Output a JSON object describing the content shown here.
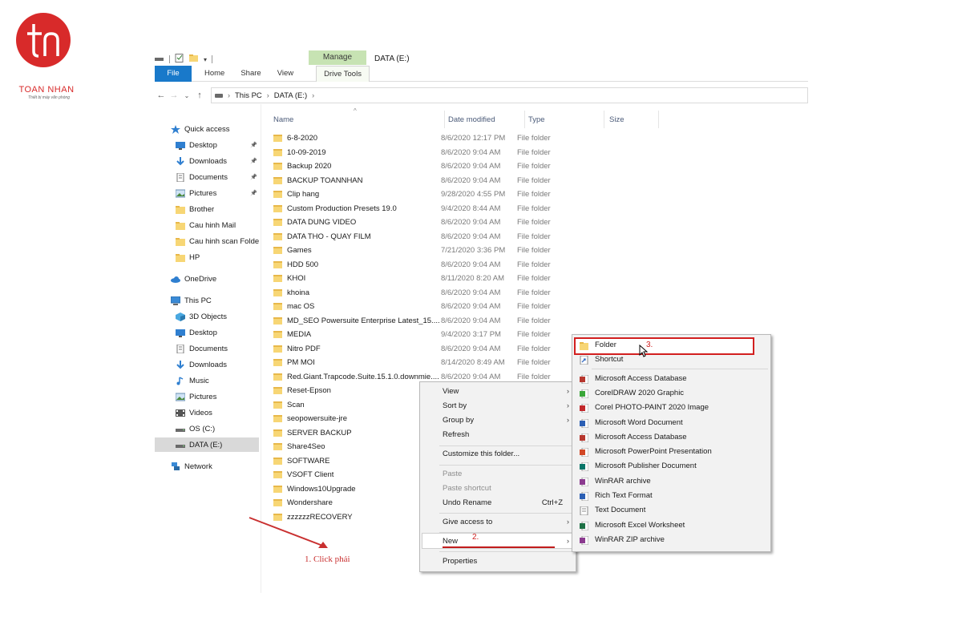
{
  "logo": {
    "name": "TOAN NHAN",
    "tagline": "Thiết bị máy văn phòng",
    "brand_color": "#d82a2a"
  },
  "window": {
    "title": "DATA (E:)",
    "context_tab": "Manage"
  },
  "ribbon": {
    "tabs": [
      "File",
      "Home",
      "Share",
      "View",
      "Drive Tools"
    ],
    "file_color": "#1979ca",
    "manage_color": "#c7e3b3"
  },
  "address": {
    "crumbs": [
      "This PC",
      "DATA (E:)"
    ]
  },
  "nav": {
    "quick_access": "Quick access",
    "items": [
      {
        "label": "Quick access",
        "icon": "star-icon"
      },
      {
        "label": "Desktop",
        "icon": "desktop-icon",
        "pinned": true
      },
      {
        "label": "Downloads",
        "icon": "download-icon",
        "pinned": true
      },
      {
        "label": "Documents",
        "icon": "documents-icon",
        "pinned": true
      },
      {
        "label": "Pictures",
        "icon": "pictures-icon",
        "pinned": true
      },
      {
        "label": "Brother",
        "icon": "folder-icon"
      },
      {
        "label": "Cau hinh Mail",
        "icon": "folder-icon"
      },
      {
        "label": "Cau hinh scan Folder",
        "icon": "folder-icon"
      },
      {
        "label": "HP",
        "icon": "folder-icon"
      },
      {
        "label": "OneDrive",
        "icon": "cloud-icon"
      },
      {
        "label": "This PC",
        "icon": "computer-icon"
      },
      {
        "label": "3D Objects",
        "icon": "cube-icon"
      },
      {
        "label": "Desktop",
        "icon": "desktop-icon"
      },
      {
        "label": "Documents",
        "icon": "documents-icon"
      },
      {
        "label": "Downloads",
        "icon": "download-icon"
      },
      {
        "label": "Music",
        "icon": "music-icon"
      },
      {
        "label": "Pictures",
        "icon": "pictures-icon"
      },
      {
        "label": "Videos",
        "icon": "video-icon"
      },
      {
        "label": "OS (C:)",
        "icon": "drive-icon"
      },
      {
        "label": "DATA (E:)",
        "icon": "drive-icon",
        "selected": true
      },
      {
        "label": "Network",
        "icon": "network-icon"
      }
    ]
  },
  "columns": {
    "name": "Name",
    "date": "Date modified",
    "type": "Type",
    "size": "Size"
  },
  "files": [
    {
      "name": "6-8-2020",
      "date": "8/6/2020 12:17 PM",
      "type": "File folder"
    },
    {
      "name": "10-09-2019",
      "date": "8/6/2020 9:04 AM",
      "type": "File folder"
    },
    {
      "name": "Backup 2020",
      "date": "8/6/2020 9:04 AM",
      "type": "File folder"
    },
    {
      "name": "BACKUP TOANNHAN",
      "date": "8/6/2020 9:04 AM",
      "type": "File folder"
    },
    {
      "name": "Clip hang",
      "date": "9/28/2020 4:55 PM",
      "type": "File folder"
    },
    {
      "name": "Custom Production Presets 19.0",
      "date": "9/4/2020 8:44 AM",
      "type": "File folder"
    },
    {
      "name": "DATA DUNG VIDEO",
      "date": "8/6/2020 9:04 AM",
      "type": "File folder"
    },
    {
      "name": "DATA THO - QUAY FILM",
      "date": "8/6/2020 9:04 AM",
      "type": "File folder"
    },
    {
      "name": "Games",
      "date": "7/21/2020 3:36 PM",
      "type": "File folder"
    },
    {
      "name": "HDD 500",
      "date": "8/6/2020 9:04 AM",
      "type": "File folder"
    },
    {
      "name": "KHOI",
      "date": "8/11/2020 8:20 AM",
      "type": "File folder"
    },
    {
      "name": "khoina",
      "date": "8/6/2020 9:04 AM",
      "type": "File folder"
    },
    {
      "name": "mac OS",
      "date": "8/6/2020 9:04 AM",
      "type": "File folder"
    },
    {
      "name": "MD_SEO Powersuite Enterprise Latest_15....",
      "date": "8/6/2020 9:04 AM",
      "type": "File folder"
    },
    {
      "name": "MEDIA",
      "date": "9/4/2020 3:17 PM",
      "type": "File folder"
    },
    {
      "name": "Nitro PDF",
      "date": "8/6/2020 9:04 AM",
      "type": "File folder"
    },
    {
      "name": "PM MOI",
      "date": "8/14/2020 8:49 AM",
      "type": "File folder"
    },
    {
      "name": "Red.Giant.Trapcode.Suite.15.1.0.downmie....",
      "date": "8/6/2020 9:04 AM",
      "type": "File folder"
    },
    {
      "name": "Reset-Epson",
      "date": "",
      "type": ""
    },
    {
      "name": "Scan",
      "date": "",
      "type": ""
    },
    {
      "name": "seopowersuite-jre",
      "date": "",
      "type": ""
    },
    {
      "name": "SERVER BACKUP",
      "date": "",
      "type": ""
    },
    {
      "name": "Share4Seo",
      "date": "",
      "type": ""
    },
    {
      "name": "SOFTWARE",
      "date": "",
      "type": ""
    },
    {
      "name": "VSOFT Client",
      "date": "",
      "type": ""
    },
    {
      "name": "Windows10Upgrade",
      "date": "",
      "type": ""
    },
    {
      "name": "Wondershare",
      "date": "",
      "type": ""
    },
    {
      "name": "zzzzzzRECOVERY",
      "date": "",
      "type": ""
    }
  ],
  "context_menu": {
    "view": "View",
    "sort_by": "Sort by",
    "group_by": "Group by",
    "refresh": "Refresh",
    "customize": "Customize this folder...",
    "paste": "Paste",
    "paste_shortcut": "Paste shortcut",
    "undo_rename": "Undo Rename",
    "undo_shortcut": "Ctrl+Z",
    "give_access": "Give access to",
    "new": "New",
    "properties": "Properties"
  },
  "new_submenu": {
    "items": [
      {
        "label": "Folder",
        "icon": "folder-icon",
        "color": "#f7d675"
      },
      {
        "label": "Shortcut",
        "icon": "shortcut-icon",
        "color": "#3a6fc4"
      },
      {
        "label": "Microsoft Access Database",
        "icon": "access-icon",
        "color": "#b7372e"
      },
      {
        "label": "CorelDRAW 2020 Graphic",
        "icon": "coreldraw-icon",
        "color": "#3aa639"
      },
      {
        "label": "Corel PHOTO-PAINT 2020 Image",
        "icon": "photopaint-icon",
        "color": "#c2282b"
      },
      {
        "label": "Microsoft Word Document",
        "icon": "word-icon",
        "color": "#2b5fb4"
      },
      {
        "label": "Microsoft Access Database",
        "icon": "access-icon",
        "color": "#b7372e"
      },
      {
        "label": "Microsoft PowerPoint Presentation",
        "icon": "powerpoint-icon",
        "color": "#d24726"
      },
      {
        "label": "Microsoft Publisher Document",
        "icon": "publisher-icon",
        "color": "#077568"
      },
      {
        "label": "WinRAR archive",
        "icon": "winrar-icon",
        "color": "#8b3a8f"
      },
      {
        "label": "Rich Text Format",
        "icon": "rtf-icon",
        "color": "#2b5fb4"
      },
      {
        "label": "Text Document",
        "icon": "text-icon",
        "color": "#888888"
      },
      {
        "label": "Microsoft Excel Worksheet",
        "icon": "excel-icon",
        "color": "#1e7145"
      },
      {
        "label": "WinRAR ZIP archive",
        "icon": "winrar-zip-icon",
        "color": "#8b3a8f"
      }
    ]
  },
  "annotations": {
    "step1": "1. Click phải",
    "step2": "2.",
    "step3": "3.",
    "annot_color": "#c93030"
  }
}
